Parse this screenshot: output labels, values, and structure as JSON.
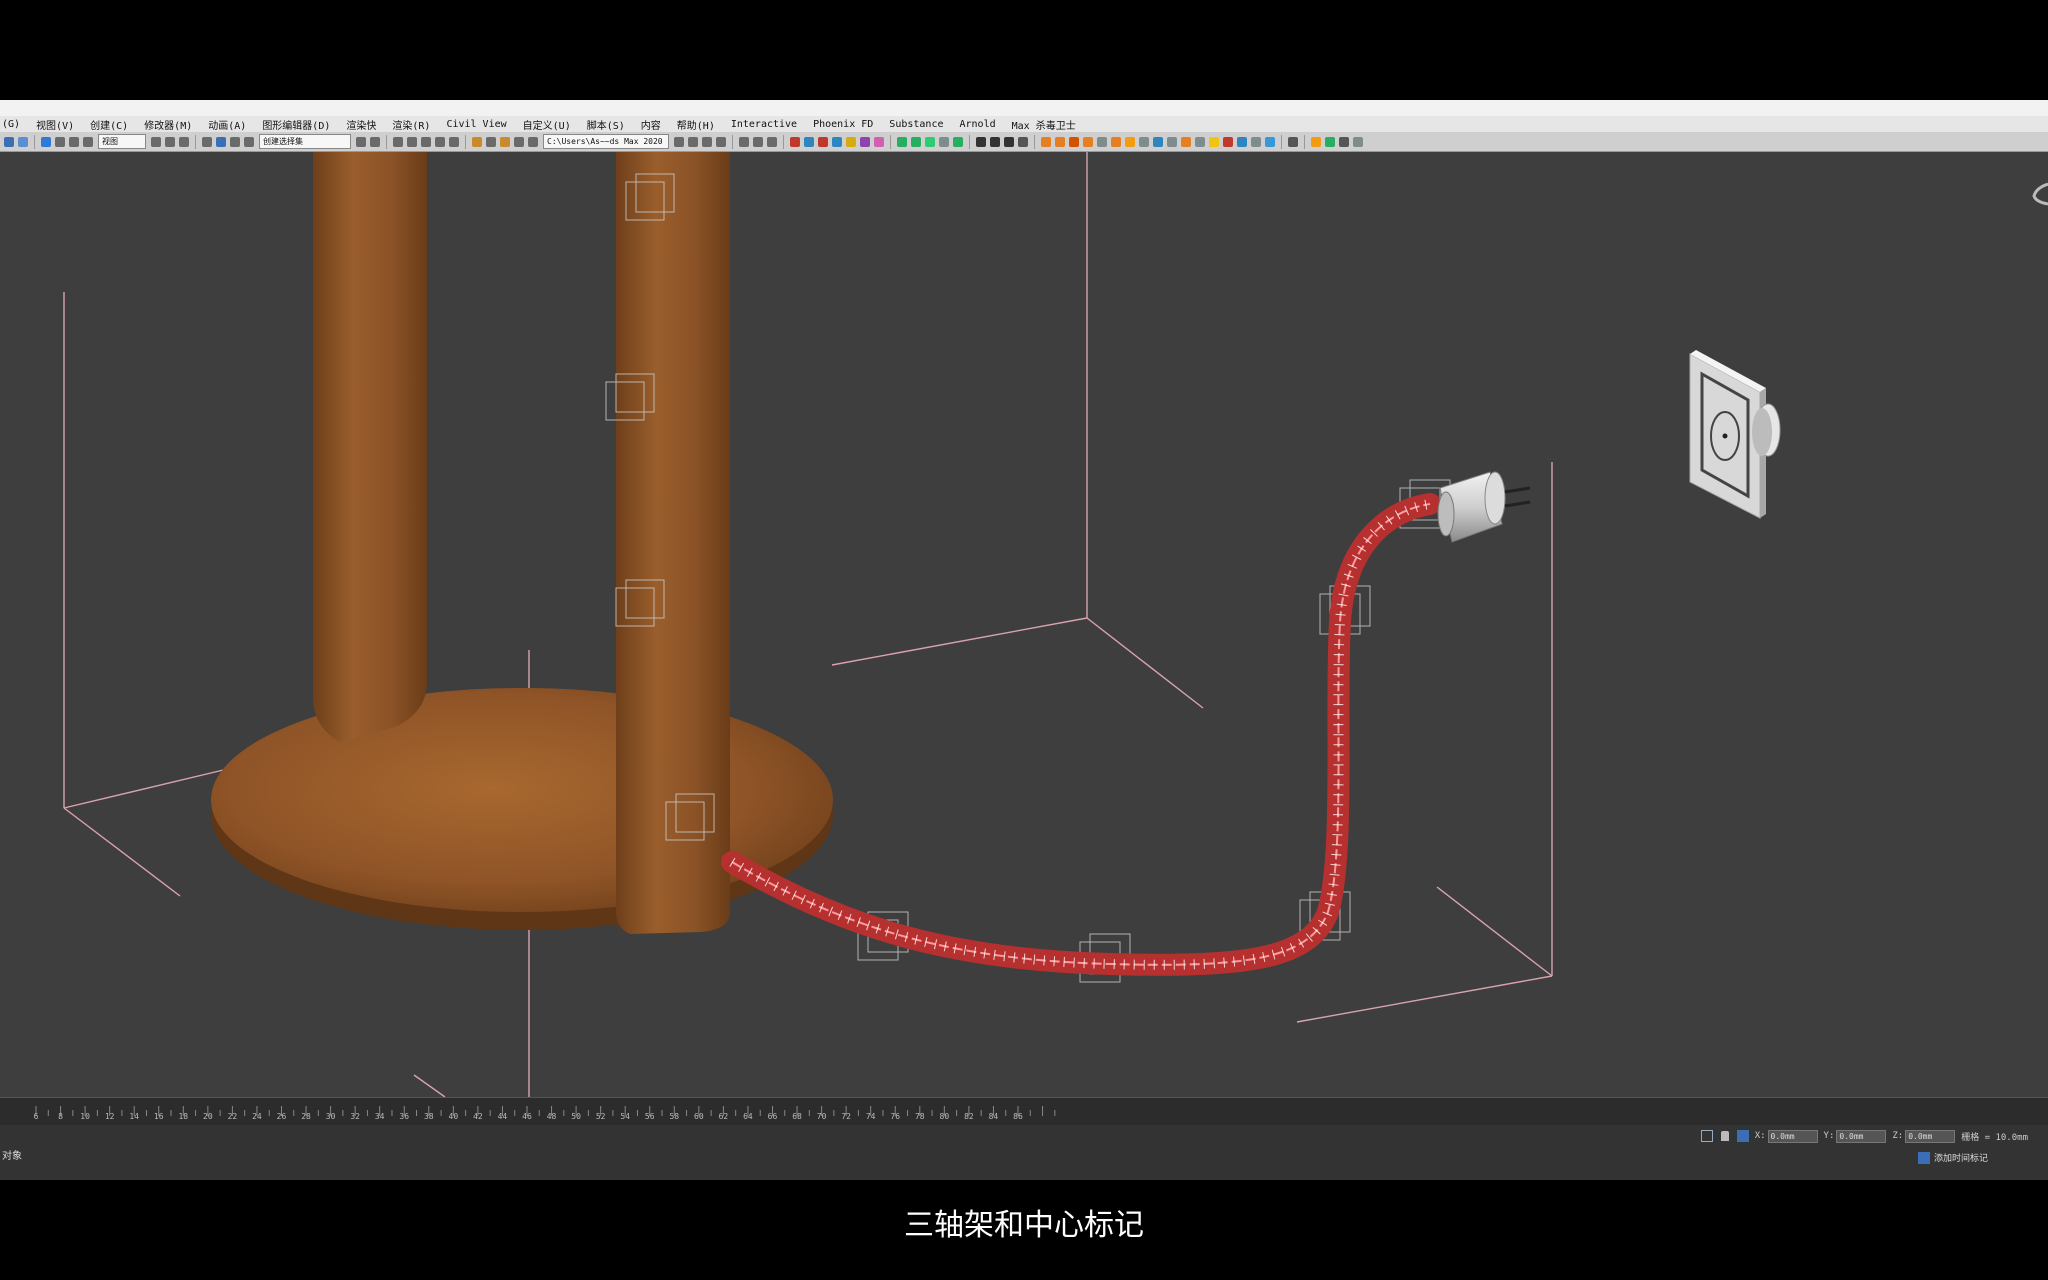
{
  "menu": {
    "items": [
      "(G)",
      "视图(V)",
      "创建(C)",
      "修改器(M)",
      "动画(A)",
      "图形编辑器(D)",
      "渲染快",
      "渲染(R)",
      "Civil View",
      "自定义(U)",
      "脚本(S)",
      "内容",
      "帮助(H)",
      "Interactive",
      "Phoenix FD",
      "Substance",
      "Arnold",
      "Max 杀毒卫士"
    ]
  },
  "toolbar": {
    "view_dropdown": "视图",
    "selection_set_placeholder": "创建选择集",
    "path_field": "C:\\Users\\As~~ds Max 2020"
  },
  "timeline": {
    "ticks": [
      "6",
      "8",
      "10",
      "12",
      "14",
      "16",
      "18",
      "20",
      "22",
      "24",
      "26",
      "28",
      "30",
      "32",
      "34",
      "36",
      "38",
      "40",
      "42",
      "44",
      "46",
      "48",
      "50",
      "52",
      "54",
      "56",
      "58",
      "60",
      "62",
      "64",
      "66",
      "68",
      "70",
      "72",
      "74",
      "76",
      "78",
      "80",
      "82",
      "84",
      "86"
    ]
  },
  "status": {
    "selection_text": "对象",
    "x_label": "X:",
    "x_value": "0.0mm",
    "y_label": "Y:",
    "y_value": "0.0mm",
    "z_label": "Z:",
    "z_value": "0.0mm",
    "grid_text": "栅格 = 10.0mm",
    "add_time_tag": "添加时间标记"
  },
  "subtitle": "三轴架和中心标记",
  "colors": {
    "viewport_bg": "#3e3e3e",
    "wood": "#8a5226",
    "cable": "#d94040",
    "bbox_lines": "#d9a3ad"
  }
}
